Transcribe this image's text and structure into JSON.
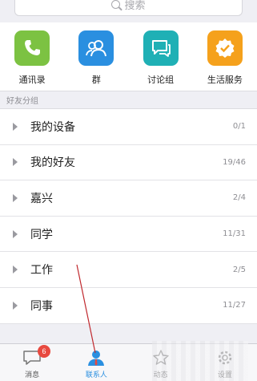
{
  "search": {
    "placeholder": "搜索"
  },
  "shortcuts": [
    {
      "label": "通讯录",
      "icon": "phone-icon",
      "color": "#7cc242"
    },
    {
      "label": "群",
      "icon": "group-icon",
      "color": "#2a8fe0"
    },
    {
      "label": "讨论组",
      "icon": "chat-icon",
      "color": "#1fb0b5"
    },
    {
      "label": "生活服务",
      "icon": "badge-check-icon",
      "color": "#f5a11c"
    }
  ],
  "section_title": "好友分组",
  "groups": [
    {
      "name": "我的设备",
      "count": "0/1"
    },
    {
      "name": "我的好友",
      "count": "19/46"
    },
    {
      "name": "嘉兴",
      "count": "2/4"
    },
    {
      "name": "同学",
      "count": "11/31"
    },
    {
      "name": "工作",
      "count": "2/5"
    },
    {
      "name": "同事",
      "count": "11/27"
    }
  ],
  "tabbar": {
    "messages": {
      "label": "消息",
      "badge": "6",
      "icon": "message-icon"
    },
    "contacts": {
      "label": "联系人",
      "icon": "contacts-icon"
    },
    "feed": {
      "label": "动态",
      "icon": "star-icon"
    },
    "settings": {
      "label": "设置",
      "icon": "gear-icon"
    },
    "active_color": "#2a8fe0"
  },
  "annotation_color": "#c0282d"
}
